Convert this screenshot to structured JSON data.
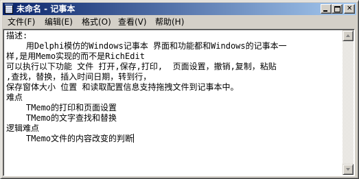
{
  "window": {
    "title": "未命名 - 记事本"
  },
  "menu": [
    {
      "label": "文件(F)"
    },
    {
      "label": "编辑(E)"
    },
    {
      "label": "格式(O)"
    },
    {
      "label": "查看(V)"
    },
    {
      "label": "帮助(H)"
    }
  ],
  "editor": {
    "lines": [
      "描述:",
      "    用Delphi模仿的Windows记事本 界面和功能都和Windows的记事本一",
      "样,是用Memo实现的而不是RichEdit",
      "可以执行以下功能 文件 打开,保存,打印,  页面设置，撤销,复制，粘贴",
      ",查找，替换，插入时间日期，转到行，",
      "保存窗体大小 位置 和读取配置信息支持拖拽文件到记事本中。",
      "难点",
      "    TMemo的打印和页面设置",
      "    TMemo的文字查找和替换",
      "逻辑难点",
      "    TMemo文件的内容改变的判断"
    ]
  },
  "icons": {
    "app": "notepad-icon",
    "minimize": "minimize-icon",
    "maximize": "maximize-icon",
    "close": "close-icon",
    "scroll_up": "arrow-up-icon",
    "scroll_down": "arrow-down-icon"
  },
  "colors": {
    "title_active_start": "#0a246a",
    "title_active_end": "#a6caf0",
    "face": "#d4d0c8",
    "editor_bg": "#ffffff"
  }
}
